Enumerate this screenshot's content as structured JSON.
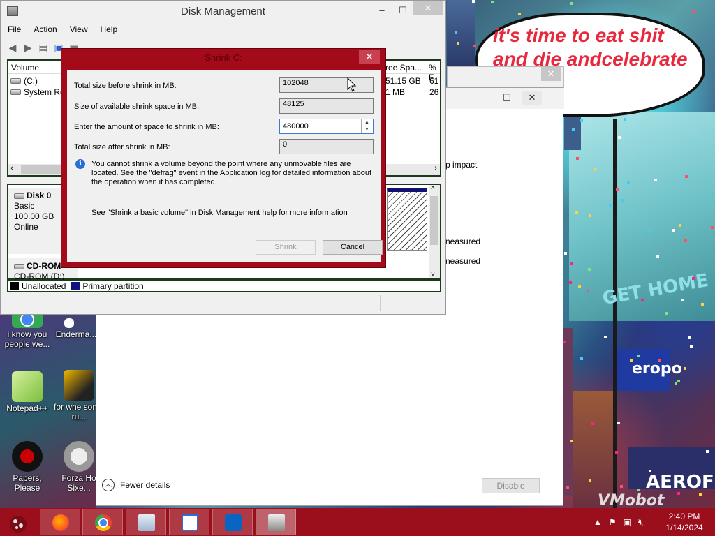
{
  "wallpaper": {
    "bubble_text": "it's time to eat shit and die andcelebrate year"
  },
  "desktop_icons": [
    {
      "label": "i know you people we..."
    },
    {
      "label": "Enderma..."
    },
    {
      "label": "Notepad++"
    },
    {
      "label": "for whe some ru..."
    },
    {
      "label": "Papers, Please"
    },
    {
      "label": "Forza Ho Sixe..."
    }
  ],
  "bg_window": {
    "col_impact": "p impact",
    "row1": "neasured",
    "row2": "neasured",
    "fewer_details": "Fewer details",
    "disable_label": "Disable",
    "max_symbol": "☐",
    "close_symbol": "✕"
  },
  "disk_management": {
    "title": "Disk Management",
    "menu": [
      "File",
      "Action",
      "View",
      "Help"
    ],
    "columns": {
      "volume": "Volume",
      "free": "ree Spa...",
      "pct": "% F"
    },
    "volumes": [
      {
        "name": "(C:)",
        "free": "51.15 GB",
        "pct": "61"
      },
      {
        "name": "System Res",
        "free": "1 MB",
        "pct": "26"
      }
    ],
    "disks": [
      {
        "name": "Disk 0",
        "type": "Basic",
        "size": "100.00 GB",
        "status": "Online"
      },
      {
        "name": "CD-ROM",
        "sub": "CD-ROM (D:)"
      }
    ],
    "legend": [
      {
        "label": "Unallocated",
        "color": "#000000"
      },
      {
        "label": "Primary partition",
        "color": "#101080"
      }
    ]
  },
  "shrink_dialog": {
    "title": "Shrink C:",
    "total_before_label": "Total size before shrink in MB:",
    "total_before_value": "102048",
    "available_label": "Size of available shrink space in MB:",
    "available_value": "48125",
    "enter_amount_label": "Enter the amount of space to shrink in MB:",
    "enter_amount_value": "480000",
    "total_after_label": "Total size after shrink in MB:",
    "total_after_value": "0",
    "info_text": "You cannot shrink a volume beyond the point where any unmovable files are located. See the \"defrag\" event in the Application log for detailed information about the operation when it has completed.",
    "help_text": "See \"Shrink a basic volume\" in Disk Management help for more information",
    "shrink_button": "Shrink",
    "cancel_button": "Cancel"
  },
  "taskbar": {
    "time": "2:40 PM",
    "date": "1/14/2024"
  }
}
